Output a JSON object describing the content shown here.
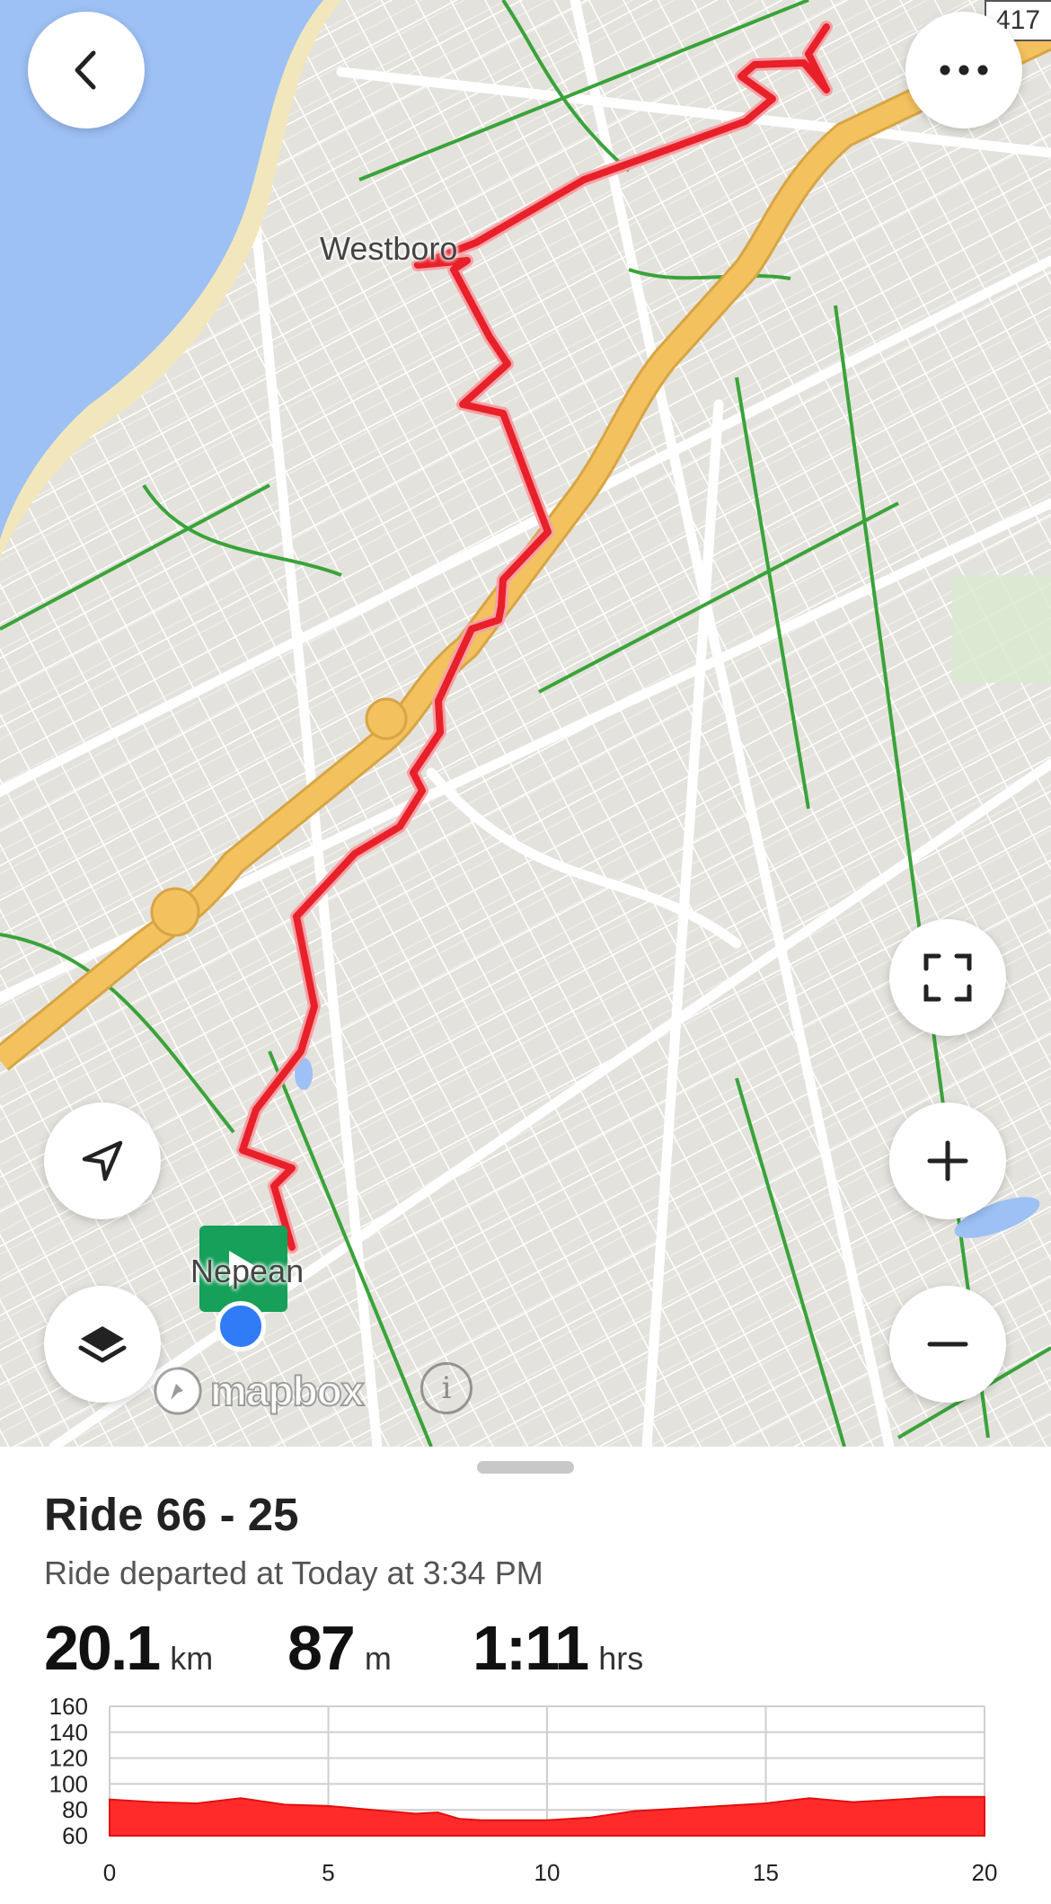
{
  "map": {
    "labels": {
      "westboro": "Westboro",
      "nepean": "Nepean",
      "highway_shield": "417"
    },
    "attribution": {
      "logo_text": "mapbox",
      "info_symbol": "i"
    },
    "colors": {
      "route": "#e8202a",
      "highway": "#f3c15e",
      "water": "#9dc0f5",
      "park_path": "#3aa33a",
      "start_marker": "#16a05a",
      "location_dot": "#2f7cf6"
    },
    "buttons": {
      "back": "chevron-left-icon",
      "more": "more-horizontal-icon",
      "fullscreen": "expand-icon",
      "locate": "navigation-arrow-icon",
      "zoom_in": "plus-icon",
      "zoom_out": "minus-icon",
      "layers": "layers-icon"
    }
  },
  "sheet": {
    "title": "Ride 66 - 25",
    "subtitle": "Ride departed at Today at 3:34 PM",
    "stats": [
      {
        "value": "20.1",
        "unit": "km"
      },
      {
        "value": "87",
        "unit": "m"
      },
      {
        "value": "1:11",
        "unit": "hrs"
      }
    ]
  },
  "chart_data": {
    "type": "area",
    "title": "",
    "xlabel": "",
    "ylabel": "",
    "xlim": [
      0,
      20
    ],
    "ylim": [
      60,
      160
    ],
    "x_ticks": [
      0,
      5,
      10,
      15,
      20
    ],
    "y_ticks": [
      160,
      140,
      120,
      100,
      80,
      60
    ],
    "grid": true,
    "series": [
      {
        "color": "#ff2b2b",
        "x": [
          0,
          1,
          2,
          3,
          4,
          5,
          6,
          7,
          7.5,
          8,
          8.5,
          9,
          10,
          11,
          12,
          13,
          14,
          15,
          16,
          17,
          18,
          19,
          20
        ],
        "y": [
          88,
          86,
          85,
          89,
          84,
          83,
          80,
          77,
          78,
          73,
          72,
          72,
          72,
          74,
          79,
          81,
          83,
          85,
          89,
          86,
          88,
          90,
          90
        ]
      }
    ]
  }
}
